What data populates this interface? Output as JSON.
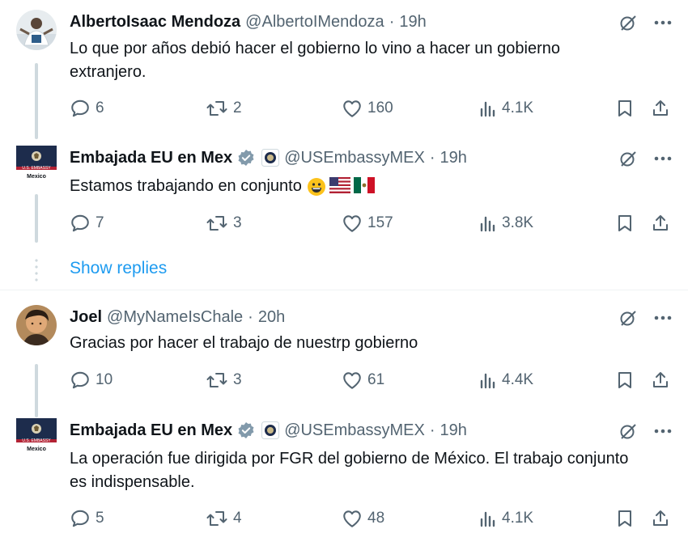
{
  "colors": {
    "accent": "#1d9bf0",
    "text": "#0f1419",
    "muted": "#536471",
    "verified": "#829aab"
  },
  "show_replies": "Show replies",
  "tweets": [
    {
      "display_name": "AlbertoIsaac Mendoza",
      "handle": "@AlbertoIMendoza",
      "separator": "·",
      "time": "19h",
      "text": "Lo que por años debió hacer el gobierno lo vino a hacer un gobierno extranjero.",
      "replies": "6",
      "retweets": "2",
      "likes": "160",
      "views": "4.1K"
    },
    {
      "display_name": "Embajada EU en Mex",
      "handle": "@USEmbassyMEX",
      "separator": "·",
      "time": "19h",
      "text": "Estamos trabajando en conjunto",
      "emojis": [
        "grinning-face",
        "flag-us",
        "flag-mx"
      ],
      "replies": "7",
      "retweets": "3",
      "likes": "157",
      "views": "3.8K",
      "avatar_label": "Mexico",
      "avatar_banner": "U.S. EMBASSY"
    },
    {
      "display_name": "Joel",
      "handle": "@MyNameIsChale",
      "separator": "·",
      "time": "20h",
      "text": "Gracias por hacer el trabajo de nuestrp gobierno",
      "replies": "10",
      "retweets": "3",
      "likes": "61",
      "views": "4.4K"
    },
    {
      "display_name": "Embajada EU en Mex",
      "handle": "@USEmbassyMEX",
      "separator": "·",
      "time": "19h",
      "text": "La operación fue dirigida por FGR del gobierno de México. El trabajo conjunto es indispensable.",
      "replies": "5",
      "retweets": "4",
      "likes": "48",
      "views": "4.1K",
      "avatar_label": "Mexico",
      "avatar_banner": "U.S. EMBASSY"
    }
  ]
}
